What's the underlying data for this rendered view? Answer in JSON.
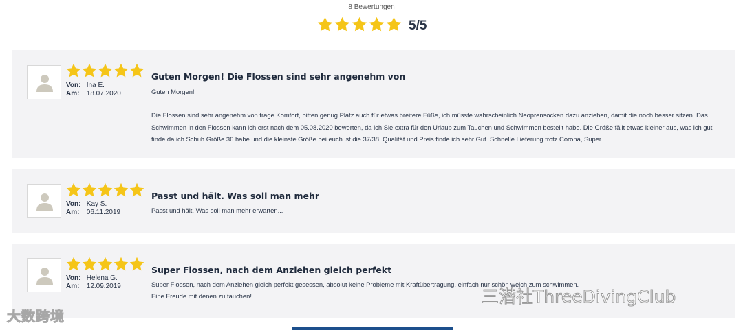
{
  "summary": {
    "count_label": "8 Bewertungen",
    "rating": 5,
    "score_text": "5/5"
  },
  "colors": {
    "star": "#f5c518",
    "card_bg": "#f3f3f5",
    "button": "#1c4f8c"
  },
  "icons": {
    "star": "star-icon",
    "avatar": "user-avatar-icon"
  },
  "meta_labels": {
    "from": "Von:",
    "date": "Am:"
  },
  "reviews": [
    {
      "rating": 5,
      "author": "Ina E.",
      "date": "18.07.2020",
      "title": "Guten Morgen! Die Flossen sind sehr angenehm von",
      "greeting": "Guten Morgen!",
      "text": "Die Flossen sind sehr angenehm von trage Komfort, bitten genug Platz auch für etwas breitere Füße, ich müsste wahrscheinlich Neoprensocken dazu anziehen, damit die noch besser sitzen. Das Schwimmen in den Flossen kann ich erst nach dem 05.08.2020 bewerten, da ich Sie extra für den Urlaub zum Tauchen und Schwimmen bestellt habe. Die Größe fällt etwas kleiner aus, was ich gut finde da ich Schuh Größe 36 habe und die kleinste Größe bei euch ist die 37/38. Qualität und Preis finde ich sehr Gut. Schnelle Lieferung trotz Corona, Super."
    },
    {
      "rating": 5,
      "author": "Kay S.",
      "date": "06.11.2019",
      "title": "Passt und hält. Was soll man mehr",
      "text": "Passt und hält. Was soll man mehr erwarten..."
    },
    {
      "rating": 5,
      "author": "Helena G.",
      "date": "12.09.2019",
      "title": "Super Flossen, nach dem Anziehen gleich perfekt",
      "text": "Super Flossen, nach dem Anziehen gleich perfekt gesessen, absolut keine Probleme mit Kraftübertragung, einfach nur schön weich zum schwimmen.",
      "text2": "Eine Freude mit denen zu tauchen!"
    }
  ],
  "watermarks": {
    "left": "大数跨境",
    "right": "三潜社ThreeDivingClub"
  }
}
